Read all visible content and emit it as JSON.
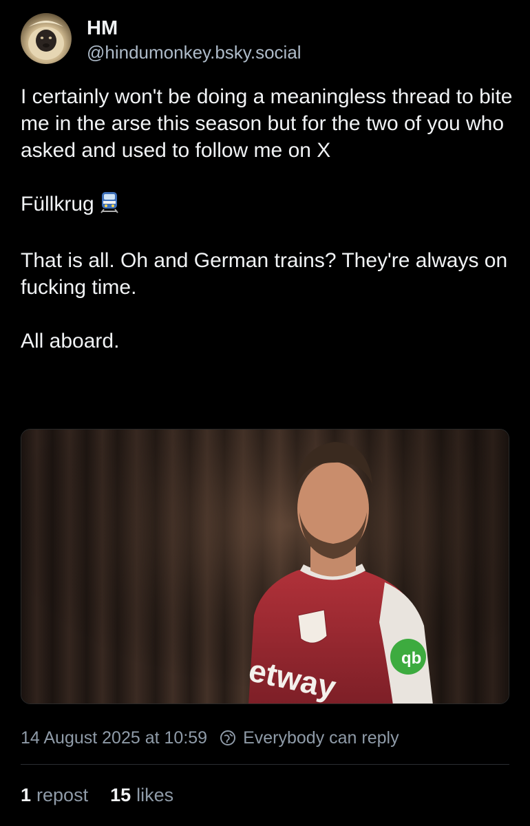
{
  "author": {
    "display_name": "HM",
    "handle": "@hindumonkey.bsky.social",
    "avatar_icon": "langur-monkey-avatar"
  },
  "post": {
    "line1": "I certainly won't be doing a meaningless thread to bite me in the arse this season but for the two of you who asked and used to follow me on X",
    "line2": "Füllkrug",
    "line2_emoji": "train-emoji",
    "line3": "That is all. Oh and German trains? They're always on fucking time.",
    "line4": "All aboard.",
    "image_icon": "player-photo"
  },
  "meta": {
    "timestamp": "14 August 2025 at 10:59",
    "reply_setting": "Everybody can reply",
    "reply_icon": "globe-reply-icon"
  },
  "stats": {
    "reposts_count": "1",
    "reposts_label": "repost",
    "likes_count": "15",
    "likes_label": "likes"
  },
  "colors": {
    "background": "#000000",
    "text": "#f1f3f5",
    "muted": "#8f9ba8",
    "handle": "#aebbc9"
  }
}
